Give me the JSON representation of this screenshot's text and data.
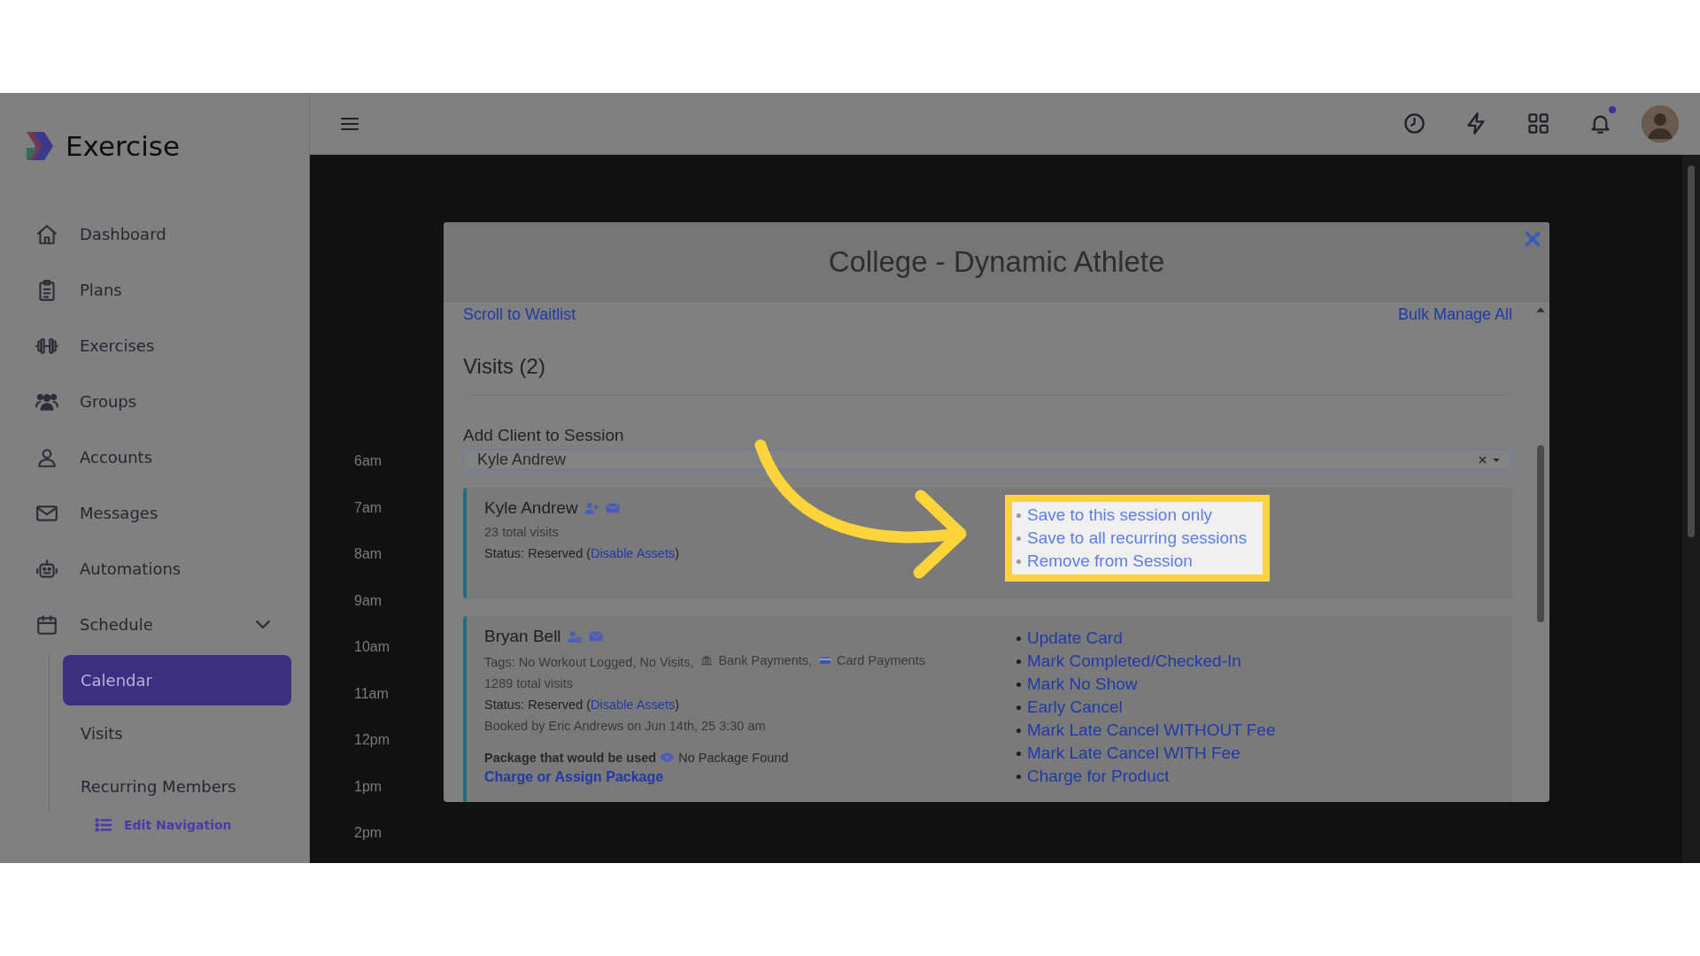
{
  "brand": {
    "name": "Exercise"
  },
  "sidebar": {
    "items": [
      {
        "label": "Dashboard",
        "kind": "link"
      },
      {
        "label": "Plans",
        "kind": "link"
      },
      {
        "label": "Exercises",
        "kind": "link"
      },
      {
        "label": "Groups",
        "kind": "link"
      },
      {
        "label": "Accounts",
        "kind": "link"
      },
      {
        "label": "Messages",
        "kind": "link"
      },
      {
        "label": "Automations",
        "kind": "link"
      },
      {
        "label": "Schedule",
        "kind": "group",
        "expanded": true,
        "children": [
          {
            "label": "Calendar",
            "selected": true
          },
          {
            "label": "Visits",
            "selected": false
          },
          {
            "label": "Recurring Members",
            "selected": false
          }
        ]
      }
    ],
    "edit_navigation": "Edit Navigation"
  },
  "topbar": {
    "notifications_unread": true
  },
  "calendar": {
    "time_labels": [
      "6am",
      "7am",
      "8am",
      "9am",
      "10am",
      "11am",
      "12pm",
      "1pm",
      "2pm"
    ]
  },
  "modal": {
    "title": "College - Dynamic Athlete",
    "scroll_link": "Scroll to Waitlist",
    "bulk_link": "Bulk Manage All",
    "visits_heading": "Visits (2)",
    "add_client": {
      "label": "Add Client to Session",
      "value": "Kyle Andrew"
    },
    "visits": [
      {
        "name": "Kyle Andrew",
        "details": [
          {
            "kind": "text",
            "text": "23 total visits"
          },
          {
            "kind": "status",
            "before": "Status: Reserved (",
            "link": "Disable Assets",
            "after": ")"
          }
        ],
        "actions": [
          "Save to this session only",
          "Save to all recurring sessions",
          "Remove from Session"
        ],
        "actions_highlighted": true
      },
      {
        "name": "Bryan Bell",
        "details": [
          {
            "kind": "tags",
            "text": "Tags: No Workout Logged, No Visits,",
            "payments": [
              "Bank Payments,",
              "Card Payments"
            ]
          },
          {
            "kind": "text",
            "text": "1289 total visits"
          },
          {
            "kind": "status",
            "before": "Status: Reserved (",
            "link": "Disable Assets",
            "after": ")"
          },
          {
            "kind": "text",
            "text": "Booked by Eric Andrews on Jun 14th, 25 3:30 am"
          },
          {
            "kind": "package",
            "label": "Package that would be used",
            "value": "No Package Found",
            "link": "Charge or Assign Package"
          }
        ],
        "actions": [
          "Update Card",
          "Mark Completed/Checked-In",
          "Mark No Show",
          "Early Cancel",
          "Mark Late Cancel WITHOUT Fee",
          "Mark Late Cancel WITH Fee",
          "Charge for Product"
        ],
        "actions_highlighted": false
      }
    ]
  }
}
